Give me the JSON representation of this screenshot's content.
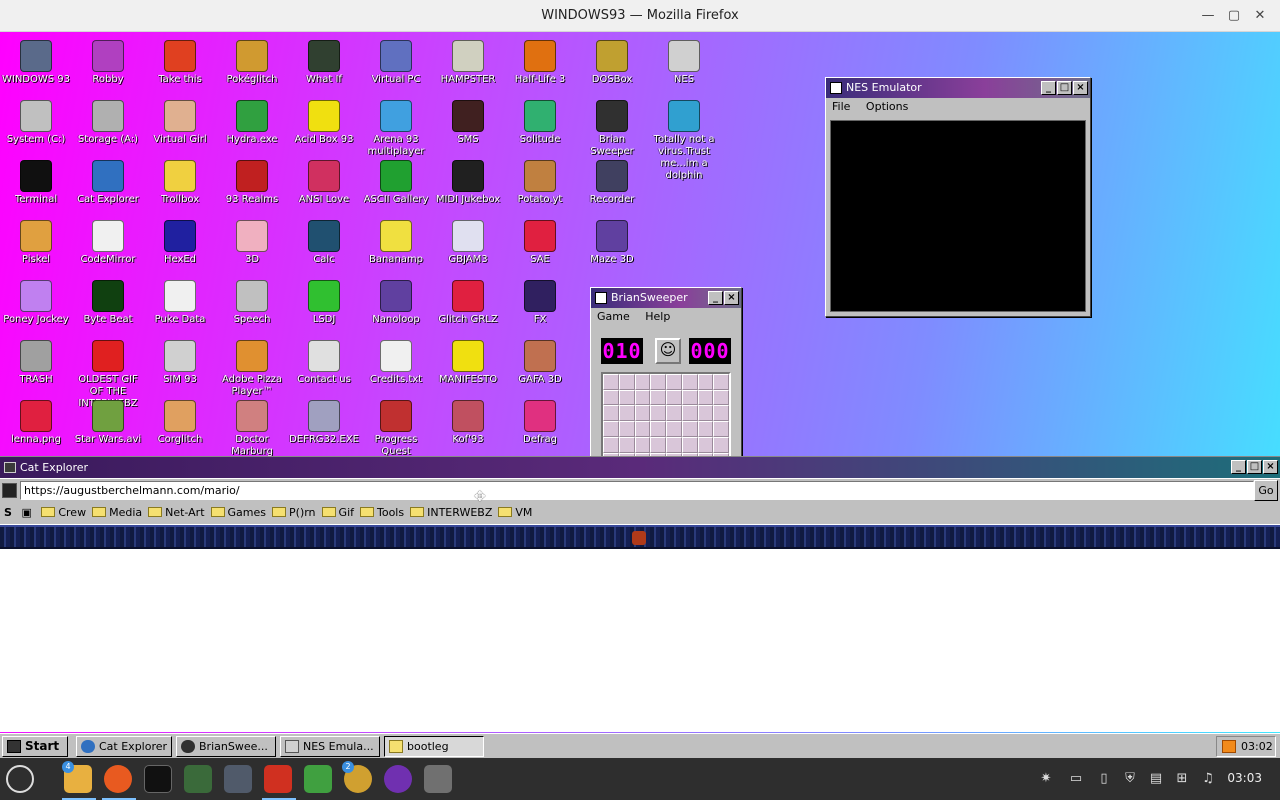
{
  "browser": {
    "title": "WINDOWS93 — Mozilla Firefox"
  },
  "desktop": {
    "icons": [
      {
        "label": "WINDOWS 93",
        "icon": "computer-icon",
        "color": "#5a6a8a"
      },
      {
        "label": "Robby",
        "icon": "robot-icon",
        "color": "#b040c0"
      },
      {
        "label": "Take this",
        "icon": "clown-icon",
        "color": "#e04020"
      },
      {
        "label": "Pokéglitch",
        "icon": "pokeball-icon",
        "color": "#d09a30"
      },
      {
        "label": "What If",
        "icon": "barcode-icon",
        "color": "#304030"
      },
      {
        "label": "Virtual PC",
        "icon": "window-icon",
        "color": "#6070c0"
      },
      {
        "label": "HAMPSTER",
        "icon": "owl-icon",
        "color": "#d0d0c0"
      },
      {
        "label": "Half-Life 3",
        "icon": "lambda-icon",
        "color": "#e07010"
      },
      {
        "label": "DOSBox",
        "icon": "dosbox-icon",
        "color": "#c0a030"
      },
      {
        "label": "NES",
        "icon": "nes-console-icon",
        "color": "#d0d0d0"
      },
      {
        "label": "System (C:)",
        "icon": "drive-icon",
        "color": "#c0c0c0"
      },
      {
        "label": "Storage (A:)",
        "icon": "floppy-drive-icon",
        "color": "#b0b0b0"
      },
      {
        "label": "Virtual Girl",
        "icon": "face-icon",
        "color": "#e0b090"
      },
      {
        "label": "Hydra.exe",
        "icon": "dragon-icon",
        "color": "#30a040"
      },
      {
        "label": "Acid Box 93",
        "icon": "smiley-icon",
        "color": "#f0e010"
      },
      {
        "label": "Arena 93 multiplayer",
        "icon": "cube-icon",
        "color": "#40a0e0"
      },
      {
        "label": "SMS",
        "icon": "sms-console-icon",
        "color": "#402020"
      },
      {
        "label": "Solitude",
        "icon": "bottle-icon",
        "color": "#30b070"
      },
      {
        "label": "Brian Sweeper",
        "icon": "mine-icon",
        "color": "#303030"
      },
      {
        "label": "Totally not a virus.Trust me...im a dolphin",
        "icon": "dolphin-icon",
        "color": "#30a0d0"
      },
      {
        "label": "Terminal",
        "icon": "terminal-icon",
        "color": "#101010"
      },
      {
        "label": "Cat Explorer",
        "icon": "globe-icon",
        "color": "#3070c0"
      },
      {
        "label": "Trollbox",
        "icon": "troll-icon",
        "color": "#f0d040"
      },
      {
        "label": "93 Realms",
        "icon": "realms-icon",
        "color": "#c02020"
      },
      {
        "label": "ANSI Love",
        "icon": "ansi-icon",
        "color": "#d03060"
      },
      {
        "label": "ASCII Gallery",
        "icon": "ascii-icon",
        "color": "#20a030"
      },
      {
        "label": "MIDI Jukebox",
        "icon": "piano-icon",
        "color": "#202020"
      },
      {
        "label": "Potato.yt",
        "icon": "potato-icon",
        "color": "#c08040"
      },
      {
        "label": "Recorder",
        "icon": "microphone-icon",
        "color": "#404060"
      },
      {
        "label": "Piskel",
        "icon": "palette-icon",
        "color": "#e0a040"
      },
      {
        "label": "CodeMirror",
        "icon": "codemirror-icon",
        "color": "#f0f0f0"
      },
      {
        "label": "HexEd",
        "icon": "hex-icon",
        "color": "#2020a0"
      },
      {
        "label": "3D",
        "icon": "teapot-icon",
        "color": "#f0b0c0"
      },
      {
        "label": "Calc",
        "icon": "calculator-icon",
        "color": "#205070"
      },
      {
        "label": "Bananamp",
        "icon": "banana-icon",
        "color": "#f0e040"
      },
      {
        "label": "GBJAM3",
        "icon": "cassette-icon",
        "color": "#e0e0f0"
      },
      {
        "label": "SAE",
        "icon": "checker-ball-icon",
        "color": "#e02040"
      },
      {
        "label": "Maze 3D",
        "icon": "maze-icon",
        "color": "#6040a0"
      },
      {
        "label": "Poney Jockey",
        "icon": "pony-icon",
        "color": "#c080f0"
      },
      {
        "label": "Byte Beat",
        "icon": "bytebeat-icon",
        "color": "#104010"
      },
      {
        "label": "Puke Data",
        "icon": "puke-icon",
        "color": "#f0f0f0"
      },
      {
        "label": "Speech",
        "icon": "speech-face-icon",
        "color": "#c0c0c0"
      },
      {
        "label": "LSDJ",
        "icon": "lsdj-icon",
        "color": "#30c030"
      },
      {
        "label": "Nanoloop",
        "icon": "waves-icon",
        "color": "#6040a0"
      },
      {
        "label": "Glitch GRLZ",
        "icon": "lips-icon",
        "color": "#e02040"
      },
      {
        "label": "FX",
        "icon": "atom-icon",
        "color": "#302060"
      },
      {
        "label": "TRASH",
        "icon": "trash-icon",
        "color": "#a0a0a0"
      },
      {
        "label": "OLDEST GIF OF THE INTERWEBZ",
        "icon": "gif-icon",
        "color": "#e02020"
      },
      {
        "label": "SIM 93",
        "icon": "sim-icon",
        "color": "#d0d0d0"
      },
      {
        "label": "Adobe Pizza Player™",
        "icon": "pizza-icon",
        "color": "#e09030"
      },
      {
        "label": "Contact us",
        "icon": "contact-icon",
        "color": "#e0e0e0"
      },
      {
        "label": "Credits.txt",
        "icon": "text-file-icon",
        "color": "#f0f0f0"
      },
      {
        "label": "MANIFESTO",
        "icon": "question-icon",
        "color": "#f0e010"
      },
      {
        "label": "GAFA 3D",
        "icon": "doom-face-icon",
        "color": "#c07050"
      },
      {
        "label": "lenna.png",
        "icon": "image-file-icon",
        "color": "#e02040"
      },
      {
        "label": "Star Wars.avi",
        "icon": "yoda-icon",
        "color": "#70a040"
      },
      {
        "label": "Corglitch",
        "icon": "corgi-icon",
        "color": "#e0a060"
      },
      {
        "label": "Doctor Marburg",
        "icon": "doctor-icon",
        "color": "#d08080"
      },
      {
        "label": "DEFRG32.EXE",
        "icon": "defrag-face-icon",
        "color": "#a0a0c0"
      },
      {
        "label": "Progress Quest",
        "icon": "swords-icon",
        "color": "#c03030"
      },
      {
        "label": "Kof'93",
        "icon": "fighter-icon",
        "color": "#c05060"
      },
      {
        "label": "Defrag",
        "icon": "defrag-icon",
        "color": "#e03080"
      }
    ]
  },
  "nes_window": {
    "title": "NES Emulator",
    "menu": [
      "File",
      "Options"
    ]
  },
  "minesweeper": {
    "title": "BrianSweeper",
    "menu": [
      "Game",
      "Help"
    ],
    "mines_left": "010",
    "timer": "000"
  },
  "cat_explorer": {
    "title": "Cat Explorer",
    "url": "https://augustberchelmann.com/mario/",
    "go_label": "Go",
    "bookmarks": [
      "Crew",
      "Media",
      "Net-Art",
      "Games",
      "P()rn",
      "Gif",
      "Tools",
      "INTERWEBZ",
      "VM"
    ]
  },
  "taskbar93": {
    "start_label": "Start",
    "tasks": [
      "Cat Explorer",
      "BrianSwee...",
      "NES Emula...",
      "bootleg"
    ],
    "time": "03:02"
  },
  "panel": {
    "clock": "03:03",
    "files_badge": "4",
    "bee_badge": "2"
  }
}
